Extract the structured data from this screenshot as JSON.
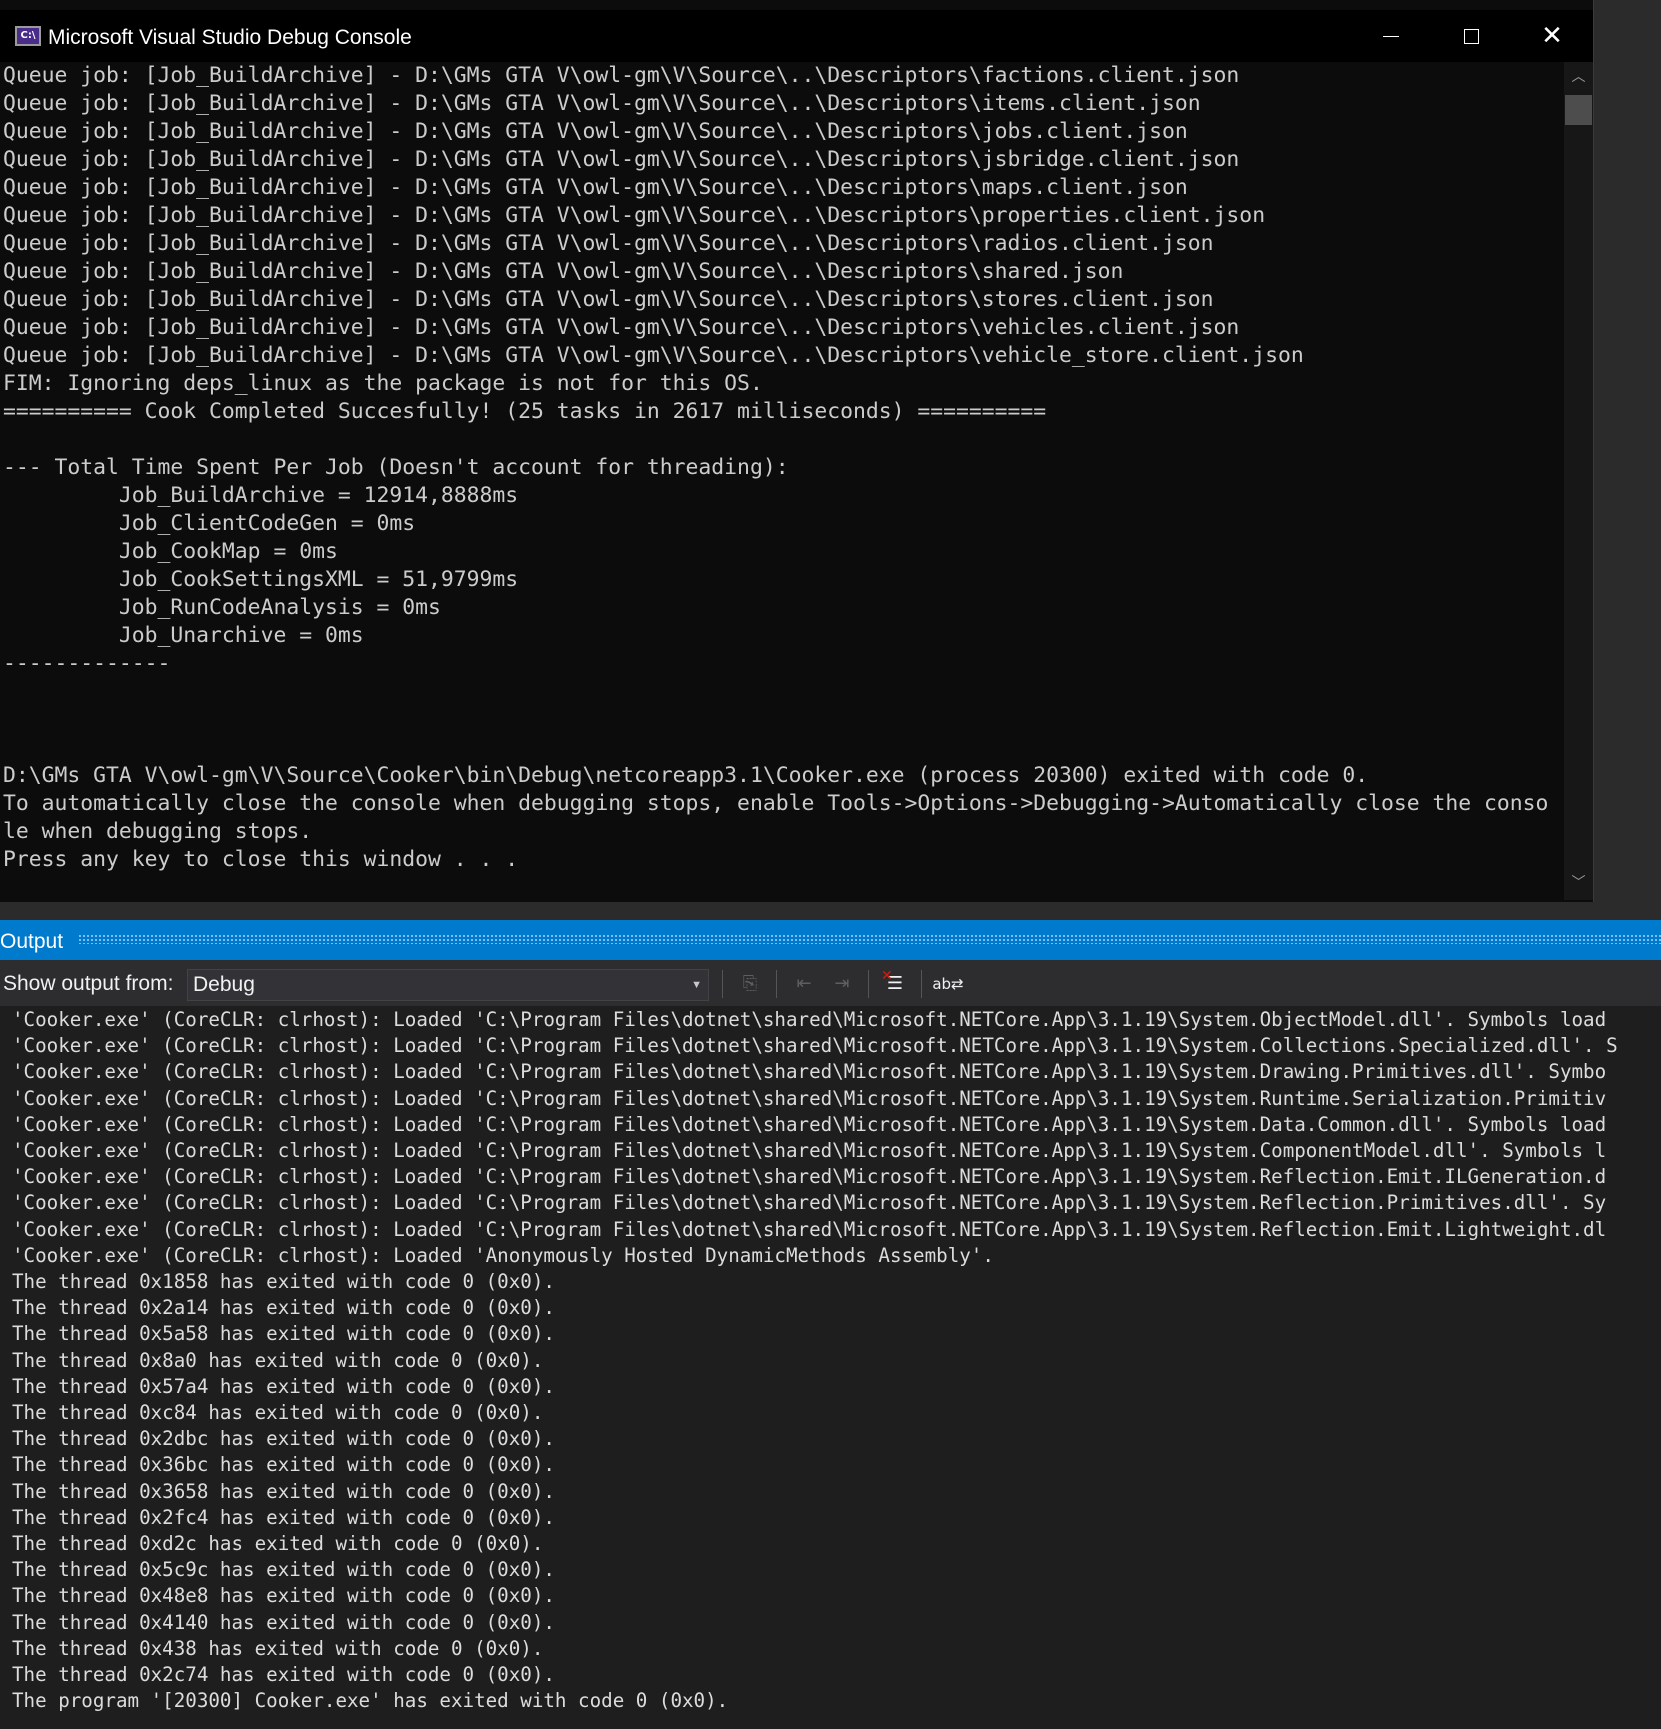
{
  "console_window": {
    "title": "Microsoft Visual Studio Debug Console",
    "icon_label": "C:\\",
    "lines": [
      "Queue job: [Job_BuildArchive] - D:\\GMs GTA V\\owl-gm\\V\\Source\\..\\Descriptors\\factions.client.json",
      "Queue job: [Job_BuildArchive] - D:\\GMs GTA V\\owl-gm\\V\\Source\\..\\Descriptors\\items.client.json",
      "Queue job: [Job_BuildArchive] - D:\\GMs GTA V\\owl-gm\\V\\Source\\..\\Descriptors\\jobs.client.json",
      "Queue job: [Job_BuildArchive] - D:\\GMs GTA V\\owl-gm\\V\\Source\\..\\Descriptors\\jsbridge.client.json",
      "Queue job: [Job_BuildArchive] - D:\\GMs GTA V\\owl-gm\\V\\Source\\..\\Descriptors\\maps.client.json",
      "Queue job: [Job_BuildArchive] - D:\\GMs GTA V\\owl-gm\\V\\Source\\..\\Descriptors\\properties.client.json",
      "Queue job: [Job_BuildArchive] - D:\\GMs GTA V\\owl-gm\\V\\Source\\..\\Descriptors\\radios.client.json",
      "Queue job: [Job_BuildArchive] - D:\\GMs GTA V\\owl-gm\\V\\Source\\..\\Descriptors\\shared.json",
      "Queue job: [Job_BuildArchive] - D:\\GMs GTA V\\owl-gm\\V\\Source\\..\\Descriptors\\stores.client.json",
      "Queue job: [Job_BuildArchive] - D:\\GMs GTA V\\owl-gm\\V\\Source\\..\\Descriptors\\vehicles.client.json",
      "Queue job: [Job_BuildArchive] - D:\\GMs GTA V\\owl-gm\\V\\Source\\..\\Descriptors\\vehicle_store.client.json",
      "FIM: Ignoring deps_linux as the package is not for this OS.",
      "========== Cook Completed Succesfully! (25 tasks in 2617 milliseconds) ==========",
      "",
      "--- Total Time Spent Per Job (Doesn't account for threading):",
      "         Job_BuildArchive = 12914,8888ms",
      "         Job_ClientCodeGen = 0ms",
      "         Job_CookMap = 0ms",
      "         Job_CookSettingsXML = 51,9799ms",
      "         Job_RunCodeAnalysis = 0ms",
      "         Job_Unarchive = 0ms",
      "-------------",
      "",
      "",
      "",
      "D:\\GMs GTA V\\owl-gm\\V\\Source\\Cooker\\bin\\Debug\\netcoreapp3.1\\Cooker.exe (process 20300) exited with code 0.",
      "To automatically close the console when debugging stops, enable Tools->Options->Debugging->Automatically close the conso",
      "le when debugging stops.",
      "Press any key to close this window . . ."
    ]
  },
  "output_panel": {
    "title": "Output",
    "show_output_label": "Show output from:",
    "source_selected": "Debug",
    "toolbar_icons": [
      "find-message-icon",
      "go-to-previous-message-icon",
      "go-to-next-message-icon",
      "clear-all-icon",
      "toggle-word-wrap-icon"
    ],
    "lines": [
      "'Cooker.exe' (CoreCLR: clrhost): Loaded 'C:\\Program Files\\dotnet\\shared\\Microsoft.NETCore.App\\3.1.19\\System.ObjectModel.dll'. Symbols load",
      "'Cooker.exe' (CoreCLR: clrhost): Loaded 'C:\\Program Files\\dotnet\\shared\\Microsoft.NETCore.App\\3.1.19\\System.Collections.Specialized.dll'. S",
      "'Cooker.exe' (CoreCLR: clrhost): Loaded 'C:\\Program Files\\dotnet\\shared\\Microsoft.NETCore.App\\3.1.19\\System.Drawing.Primitives.dll'. Symbo",
      "'Cooker.exe' (CoreCLR: clrhost): Loaded 'C:\\Program Files\\dotnet\\shared\\Microsoft.NETCore.App\\3.1.19\\System.Runtime.Serialization.Primitiv",
      "'Cooker.exe' (CoreCLR: clrhost): Loaded 'C:\\Program Files\\dotnet\\shared\\Microsoft.NETCore.App\\3.1.19\\System.Data.Common.dll'. Symbols load",
      "'Cooker.exe' (CoreCLR: clrhost): Loaded 'C:\\Program Files\\dotnet\\shared\\Microsoft.NETCore.App\\3.1.19\\System.ComponentModel.dll'. Symbols l",
      "'Cooker.exe' (CoreCLR: clrhost): Loaded 'C:\\Program Files\\dotnet\\shared\\Microsoft.NETCore.App\\3.1.19\\System.Reflection.Emit.ILGeneration.d",
      "'Cooker.exe' (CoreCLR: clrhost): Loaded 'C:\\Program Files\\dotnet\\shared\\Microsoft.NETCore.App\\3.1.19\\System.Reflection.Primitives.dll'. Sy",
      "'Cooker.exe' (CoreCLR: clrhost): Loaded 'C:\\Program Files\\dotnet\\shared\\Microsoft.NETCore.App\\3.1.19\\System.Reflection.Emit.Lightweight.dl",
      "'Cooker.exe' (CoreCLR: clrhost): Loaded 'Anonymously Hosted DynamicMethods Assembly'.",
      "The thread 0x1858 has exited with code 0 (0x0).",
      "The thread 0x2a14 has exited with code 0 (0x0).",
      "The thread 0x5a58 has exited with code 0 (0x0).",
      "The thread 0x8a0 has exited with code 0 (0x0).",
      "The thread 0x57a4 has exited with code 0 (0x0).",
      "The thread 0xc84 has exited with code 0 (0x0).",
      "The thread 0x2dbc has exited with code 0 (0x0).",
      "The thread 0x36bc has exited with code 0 (0x0).",
      "The thread 0x3658 has exited with code 0 (0x0).",
      "The thread 0x2fc4 has exited with code 0 (0x0).",
      "The thread 0xd2c has exited with code 0 (0x0).",
      "The thread 0x5c9c has exited with code 0 (0x0).",
      "The thread 0x48e8 has exited with code 0 (0x0).",
      "The thread 0x4140 has exited with code 0 (0x0).",
      "The thread 0x438 has exited with code 0 (0x0).",
      "The thread 0x2c74 has exited with code 0 (0x0).",
      "The program '[20300] Cooker.exe' has exited with code 0 (0x0)."
    ]
  },
  "colors": {
    "console_bg": "#0c0c0c",
    "console_text": "#cccccc",
    "accent": "#007acc",
    "output_bg": "#1e1e1e",
    "output_text": "#dcdcdc"
  }
}
